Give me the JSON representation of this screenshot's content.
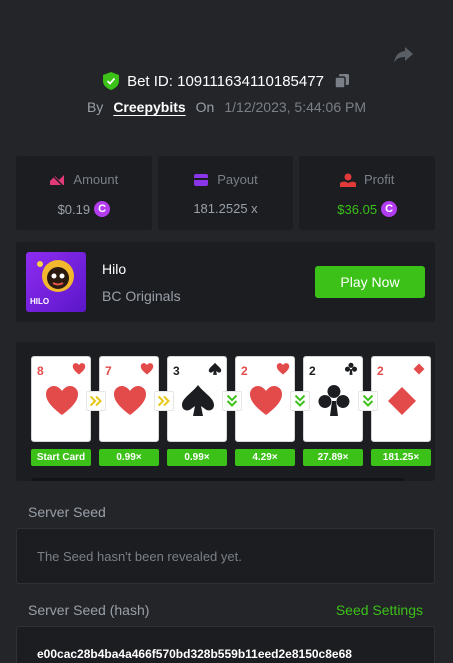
{
  "header": {
    "bet_id_label": "Bet ID: 109111634110185477",
    "by_label": "By",
    "username": "Creepybits",
    "on_label": "On",
    "datetime": "1/12/2023, 5:44:06 PM",
    "icons": {
      "share": "share-icon",
      "shield": "shield-check-icon",
      "copy": "copy-icon"
    }
  },
  "stats": {
    "amount": {
      "label": "Amount",
      "value": "$0.19",
      "coin": "C"
    },
    "payout": {
      "label": "Payout",
      "value": "181.2525 x"
    },
    "profit": {
      "label": "Profit",
      "value": "$36.05",
      "coin": "C"
    }
  },
  "game": {
    "thumb_label": "HILO",
    "title": "Hilo",
    "subtitle": "BC Originals",
    "play_label": "Play Now"
  },
  "cards": [
    {
      "rank": "8",
      "suit": "hearts",
      "multiplier": "Start Card"
    },
    {
      "rank": "7",
      "suit": "hearts",
      "multiplier": "0.99×"
    },
    {
      "rank": "3",
      "suit": "spades",
      "multiplier": "0.99×"
    },
    {
      "rank": "2",
      "suit": "hearts",
      "multiplier": "4.29×"
    },
    {
      "rank": "2",
      "suit": "clubs",
      "multiplier": "27.89×"
    },
    {
      "rank": "2",
      "suit": "diamonds",
      "multiplier": "181.25×"
    }
  ],
  "arrows": [
    "higher",
    "higher",
    "lower",
    "lower",
    "lower"
  ],
  "server_seed": {
    "label": "Server Seed",
    "message": "The Seed hasn't been revealed yet."
  },
  "server_seed_hash": {
    "label": "Server Seed (hash)",
    "settings_label": "Seed Settings",
    "value": "e00cac28b4ba4a466f570bd328b559b11eed2e8150c8e68"
  },
  "colors": {
    "accent": "#3bc117",
    "coin": "#b43cf0",
    "red_suit": "#e34a4a",
    "panel": "#1b1d21",
    "bg": "#232529"
  }
}
